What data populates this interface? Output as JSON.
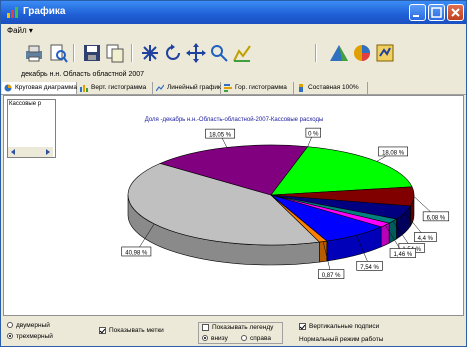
{
  "window": {
    "title": "Графика"
  },
  "menu": {
    "items": [
      "Файл ▾"
    ]
  },
  "toolbar": {
    "icons": [
      "print-icon",
      "preview-icon",
      "save-icon",
      "copy-icon",
      "pattern-icon",
      "rotate-icon",
      "move-icon",
      "zoom-icon",
      "chart-style-icon",
      "palette-icon",
      "pie-type-icon",
      "settings-icon"
    ]
  },
  "path_text": "декабрь н.н. Область областной 2007",
  "tabs": [
    {
      "label": "Круговая диаграмма",
      "active": true
    },
    {
      "label": "Верт. гистограмма",
      "active": false
    },
    {
      "label": "Линейный график",
      "active": false
    },
    {
      "label": "Гор. гистограмма",
      "active": false
    },
    {
      "label": "Составная 100%",
      "active": false
    }
  ],
  "left_list": {
    "item": "Кассовые р"
  },
  "chart_data": {
    "type": "pie",
    "title": "Доля -декабрь н.н.-Область-областной-2007-Кассовые расходы",
    "slices": [
      {
        "label": "40,98 %",
        "value": 40.98,
        "color": "#c0c0c0"
      },
      {
        "label": "18,05 %",
        "value": 18.05,
        "color": "#800080"
      },
      {
        "label": "0 %",
        "value": 0.0,
        "color": "#ffff00"
      },
      {
        "label": "18,08 %",
        "value": 18.08,
        "color": "#00ff00"
      },
      {
        "label": "6,08 %",
        "value": 6.08,
        "color": "#800000"
      },
      {
        "label": "4,4 %",
        "value": 4.4,
        "color": "#000080"
      },
      {
        "label": "1,54 %",
        "value": 1.54,
        "color": "#008080"
      },
      {
        "label": "1,46 %",
        "value": 1.46,
        "color": "#ff00ff"
      },
      {
        "label": "7,54 %",
        "value": 7.54,
        "color": "#0000ff"
      },
      {
        "label": "0,87 %",
        "value": 0.87,
        "color": "#ff8000"
      }
    ]
  },
  "options": {
    "flat": "двумерный",
    "three_d": "трехмерный",
    "show_marks": "Показывать метки",
    "show_legend": "Показывать легенду",
    "legend_bottom": "внизу",
    "legend_right": "справа",
    "vertical_labels": "Вертикальные подписи",
    "mode": "Нормальный режим работы"
  }
}
